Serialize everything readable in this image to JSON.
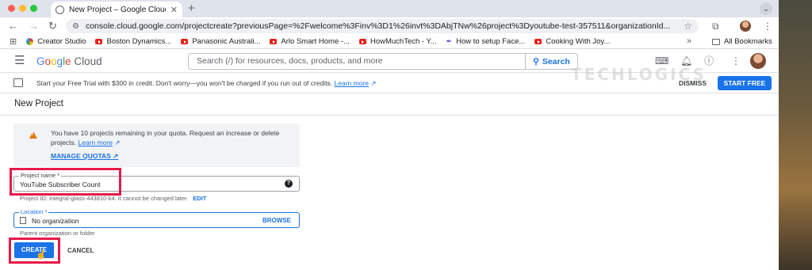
{
  "browser": {
    "tab_title": "New Project – Google Cloud c",
    "url": "console.cloud.google.com/projectcreate?previousPage=%2Fwelcome%3Finv%3D1%26invt%3DAbjTNw%26project%3Dyoutube-test-357511&organizationId...",
    "bookmarks": [
      "Creator Studio",
      "Boston Dynamics...",
      "Panasonic Australi...",
      "Arlo Smart Home -...",
      "HowMuchTech - Y...",
      "How to setup Face...",
      "Cooking With Joy..."
    ],
    "more_label": "»",
    "all_bookmarks": "All Bookmarks"
  },
  "header": {
    "search_placeholder": "Search (/) for resources, docs, products, and more",
    "search_button": "Search"
  },
  "trial": {
    "message": "Start your Free Trial with $300 in credit. Don't worry—you won't be charged if you run out of credits.",
    "learn_more": "Learn more",
    "dismiss": "DISMISS",
    "start_free": "START FREE"
  },
  "watermark": "TECHLOGICS",
  "page": {
    "title": "New Project",
    "quota_text": "You have 10 projects remaining in your quota. Request an increase or delete projects.",
    "quota_learn_more": "Learn more",
    "manage_quotas": "MANAGE QUOTAS",
    "project_name_label": "Project name *",
    "project_name_value": "YouTube Subscriber Count",
    "project_id_text": "Project ID: integral-glass-443810-k4. It cannot be changed later.",
    "edit_label": "EDIT",
    "location_label": "Location *",
    "location_value": "No organization",
    "browse_label": "BROWSE",
    "location_helper": "Parent organization or folder",
    "create_label": "CREATE",
    "cancel_label": "CANCEL"
  },
  "colors": {
    "accent": "#1a73e8",
    "highlight": "#e6194b",
    "warning": "#e37400"
  }
}
